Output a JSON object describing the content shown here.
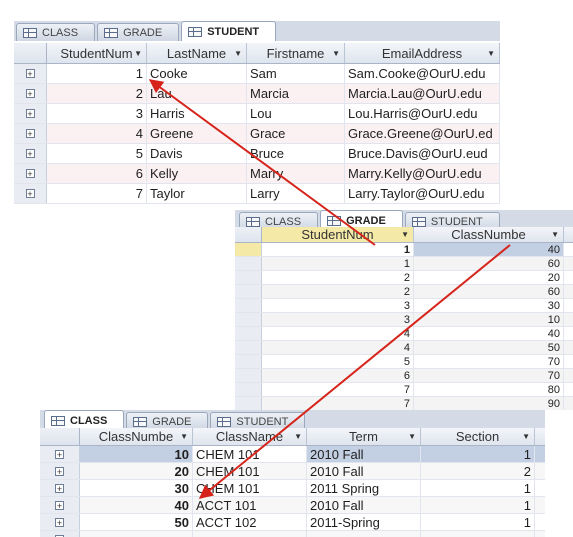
{
  "student_table": {
    "tabs": [
      "CLASS",
      "GRADE",
      "STUDENT"
    ],
    "active_tab": 2,
    "columns": [
      "StudentNum",
      "LastName",
      "Firstname",
      "EmailAddress"
    ],
    "rows": [
      {
        "num": "1",
        "last": "Cooke",
        "first": "Sam",
        "email": "Sam.Cooke@OurU.edu"
      },
      {
        "num": "2",
        "last": "Lau",
        "first": "Marcia",
        "email": "Marcia.Lau@OurU.edu"
      },
      {
        "num": "3",
        "last": "Harris",
        "first": "Lou",
        "email": "Lou.Harris@OurU.edu"
      },
      {
        "num": "4",
        "last": "Greene",
        "first": "Grace",
        "email": "Grace.Greene@OurU.ed"
      },
      {
        "num": "5",
        "last": "Davis",
        "first": "Bruce",
        "email": "Bruce.Davis@OurU.eud"
      },
      {
        "num": "6",
        "last": "Kelly",
        "first": "Marry",
        "email": "Marry.Kelly@OurU.edu"
      },
      {
        "num": "7",
        "last": "Taylor",
        "first": "Larry",
        "email": "Larry.Taylor@OurU.edu"
      }
    ]
  },
  "grade_table": {
    "tabs": [
      "CLASS",
      "GRADE",
      "STUDENT"
    ],
    "active_tab": 1,
    "columns": [
      "StudentNum",
      "ClassNumbe"
    ],
    "rows": [
      {
        "student": "1",
        "class": "40"
      },
      {
        "student": "1",
        "class": "60"
      },
      {
        "student": "2",
        "class": "20"
      },
      {
        "student": "2",
        "class": "60"
      },
      {
        "student": "3",
        "class": "30"
      },
      {
        "student": "3",
        "class": "10"
      },
      {
        "student": "4",
        "class": "40"
      },
      {
        "student": "4",
        "class": "50"
      },
      {
        "student": "5",
        "class": "70"
      },
      {
        "student": "6",
        "class": "70"
      },
      {
        "student": "7",
        "class": "80"
      },
      {
        "student": "7",
        "class": "90"
      }
    ]
  },
  "class_table": {
    "tabs": [
      "CLASS",
      "GRADE",
      "STUDENT"
    ],
    "active_tab": 0,
    "columns": [
      "ClassNumbe",
      "ClassName",
      "Term",
      "Section"
    ],
    "rows": [
      {
        "num": "10",
        "name": "CHEM 101",
        "term": "2010 Fall",
        "section": "1"
      },
      {
        "num": "20",
        "name": "CHEM 101",
        "term": "2010 Fall",
        "section": "2"
      },
      {
        "num": "30",
        "name": "CHEM 101",
        "term": "2011 Spring",
        "section": "1"
      },
      {
        "num": "40",
        "name": "ACCT 101",
        "term": "2010 Fall",
        "section": "1"
      },
      {
        "num": "50",
        "name": "ACCT 102",
        "term": "2011-Spring",
        "section": "1"
      },
      {
        "num": "",
        "name": "",
        "term": "",
        "section": ""
      }
    ]
  },
  "colors": {
    "arrow": "#d6241b",
    "tab_bar": "#d4dbe7",
    "selected_row": "#c3cfe2"
  }
}
